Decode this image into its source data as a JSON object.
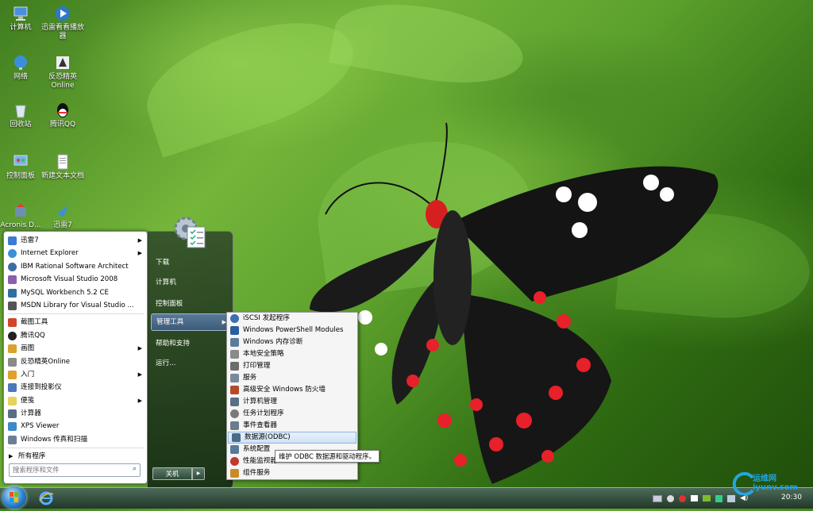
{
  "desktop": {
    "icons": [
      {
        "label": "计算机",
        "icon": "computer-icon",
        "interactable": true
      },
      {
        "label": "迅雷看看播放器",
        "icon": "xunlei-player-icon",
        "interactable": true
      },
      {
        "label": "网络",
        "icon": "network-icon",
        "interactable": true
      },
      {
        "label": "反恐精英Online",
        "icon": "cs-online-icon",
        "interactable": true
      },
      {
        "label": "回收站",
        "icon": "recycle-bin-icon",
        "interactable": true
      },
      {
        "label": "腾讯QQ",
        "icon": "qq-icon",
        "interactable": true
      },
      {
        "label": "控制面板",
        "icon": "control-panel-icon",
        "interactable": true
      },
      {
        "label": "新建文本文档",
        "icon": "text-document-icon",
        "interactable": true
      },
      {
        "label": "Acronis D...",
        "icon": "acronis-icon",
        "interactable": true
      },
      {
        "label": "迅雷7",
        "icon": "xunlei7-icon",
        "interactable": true
      }
    ]
  },
  "start_menu": {
    "programs": [
      {
        "label": "迅雷7",
        "submenu": true,
        "color": "#3a7bd5"
      },
      {
        "label": "Internet Explorer",
        "submenu": true,
        "color": "#3b8fd9"
      },
      {
        "label": "IBM Rational Software Architect",
        "submenu": false,
        "color": "#3a6ea5"
      },
      {
        "label": "Microsoft Visual Studio 2008",
        "submenu": false,
        "color": "#8a5fb0"
      },
      {
        "label": "MySQL Workbench 5.2 CE",
        "submenu": false,
        "color": "#2f6f9f"
      },
      {
        "label": "MSDN Library for Visual Studio ...",
        "submenu": false,
        "color": "#555555"
      },
      {
        "label": "截图工具",
        "submenu": false,
        "color": "#d2452b"
      },
      {
        "label": "腾讯QQ",
        "submenu": false,
        "color": "#222222"
      },
      {
        "label": "画图",
        "submenu": true,
        "color": "#d9a22b"
      },
      {
        "label": "反恐精英Online",
        "submenu": false,
        "color": "#8a8a8a"
      },
      {
        "label": "入门",
        "submenu": true,
        "color": "#e0a02a"
      },
      {
        "label": "连接到投影仪",
        "submenu": false,
        "color": "#4a78b8"
      },
      {
        "label": "便笺",
        "submenu": true,
        "color": "#e6d35a"
      },
      {
        "label": "计算器",
        "submenu": false,
        "color": "#5a6f85"
      },
      {
        "label": "XPS Viewer",
        "submenu": false,
        "color": "#3d88c9"
      },
      {
        "label": "Windows 传真和扫描",
        "submenu": false,
        "color": "#6b7f94"
      }
    ],
    "all_programs": "所有程序",
    "search_placeholder": "搜索程序和文件",
    "right_items": [
      "下载",
      "计算机",
      "控制面板",
      "管理工具",
      "帮助和支持",
      "运行..."
    ],
    "shutdown_label": "关机"
  },
  "admin_tools": {
    "items": [
      {
        "label": "iSCSI 发起程序",
        "color": "#3a6fb0"
      },
      {
        "label": "Windows PowerShell Modules",
        "color": "#2b5c9e"
      },
      {
        "label": "Windows 内存诊断",
        "color": "#5c7c9c"
      },
      {
        "label": "本地安全策略",
        "color": "#8a8a8a"
      },
      {
        "label": "打印管理",
        "color": "#6d6d6d"
      },
      {
        "label": "服务",
        "color": "#7a8a9a"
      },
      {
        "label": "高级安全 Windows 防火墙",
        "color": "#b44a2a"
      },
      {
        "label": "计算机管理",
        "color": "#5a6f85"
      },
      {
        "label": "任务计划程序",
        "color": "#7a7a7a"
      },
      {
        "label": "事件查看器",
        "color": "#6a7c8e"
      },
      {
        "label": "数据源(ODBC)",
        "color": "#4a6a8a",
        "highlighted": true
      },
      {
        "label": "系统配置",
        "color": "#5a7a9a"
      },
      {
        "label": "性能监视器",
        "color": "#c0392b"
      },
      {
        "label": "组件服务",
        "color": "#c98a2a"
      }
    ],
    "tooltip": "维护 ODBC 数据源和驱动程序。"
  },
  "taskbar": {
    "clock": "20:30",
    "watermark": "运维网 iyunv.com"
  }
}
